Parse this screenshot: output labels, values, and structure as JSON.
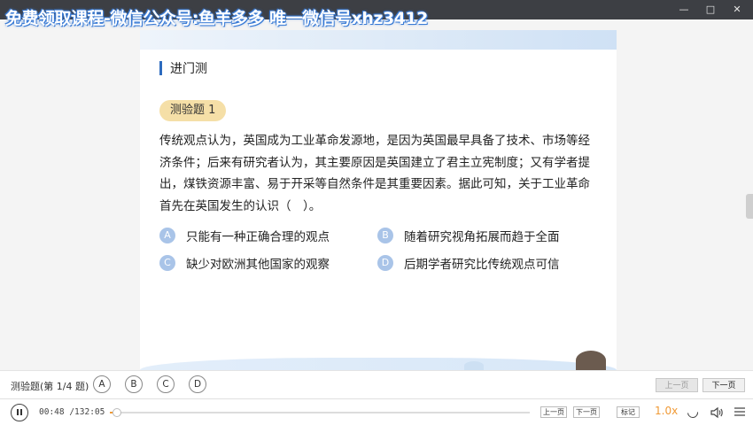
{
  "window": {
    "watermark": "免费领取课程-微信公众号:鱼羊多多 唯一微信号xhz3412",
    "controls": [
      "—",
      "□",
      "✕"
    ]
  },
  "lesson": {
    "section_title": "进门测",
    "quiz_badge": "测验题 1",
    "question": "传统观点认为，英国成为工业革命发源地，是因为英国最早具备了技术、市场等经济条件；后来有研究者认为，其主要原因是英国建立了君主立宪制度；又有学者提出，煤铁资源丰富、易于开采等自然条件是其重要因素。据此可知，关于工业革命首先在英国发生的认识（　）。",
    "options": [
      {
        "letter": "A",
        "text": "只能有一种正确合理的观点"
      },
      {
        "letter": "B",
        "text": "随着研究视角拓展而趋于全面"
      },
      {
        "letter": "C",
        "text": "缺少对欧洲其他国家的观察"
      },
      {
        "letter": "D",
        "text": "后期学者研究比传统观点可信"
      }
    ]
  },
  "quiz_bar": {
    "label": "测验题(第 1/4 题)",
    "answers": [
      "A",
      "B",
      "C",
      "D"
    ],
    "prev_page": "上一页",
    "next_page": "下一页"
  },
  "player": {
    "time": "00:48 /132:05",
    "progress_fraction": 0.006,
    "prev_label": "上一页",
    "next_label": "下一页",
    "note_label": "标记",
    "speed": "1.0x",
    "accent_color": "#f09a36"
  }
}
